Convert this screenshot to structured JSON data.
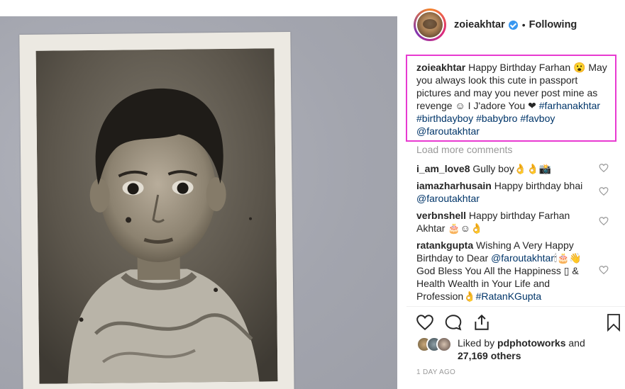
{
  "post": {
    "username": "zoieakhtar",
    "separator": "•",
    "follow_status": "Following"
  },
  "caption": {
    "username": "zoieakhtar",
    "text": " Happy Birthday Farhan 😮 May you always look this cute in passport pictures and may you never post mine as revenge ☺ I J'adore You ❤ ",
    "hashtags": [
      "#farhanakhtar",
      "#birthdayboy",
      "#babybro",
      "#favboy"
    ],
    "mention": "@faroutakhtar"
  },
  "load_more_label": "Load more comments",
  "comments": [
    {
      "username": "i_am_love8",
      "text": " Gully boy👌👌📸"
    },
    {
      "username": "iamazharhusain",
      "text": " Happy birthday bhai ",
      "mention": "@faroutakhtar"
    },
    {
      "username": "verbnshell",
      "text": " Happy birthday Farhan Akhtar 🎂☺👌"
    },
    {
      "username": "ratankgupta",
      "text": " Wishing A Very Happy Birthday to Dear ",
      "mention": "@faroutakhtar",
      "text2": "🕯🎂👋 God Bless You All the Happiness ▯ & Health Wealth in Your Life and Profession👌",
      "hashtag": "#RatanKGupta"
    }
  ],
  "likes": {
    "prefix": "Liked by ",
    "user": "pdphotoworks",
    "middle": " and ",
    "count": "27,169 others"
  },
  "timestamp": "1 DAY AGO",
  "colors": {
    "highlight_border": "#e83ad1",
    "link": "#003569",
    "muted": "#999999",
    "verified": "#3897f0"
  },
  "icons": [
    "verified-badge-icon",
    "heart-icon",
    "comment-icon",
    "share-icon",
    "bookmark-icon",
    "small-heart-icon"
  ]
}
